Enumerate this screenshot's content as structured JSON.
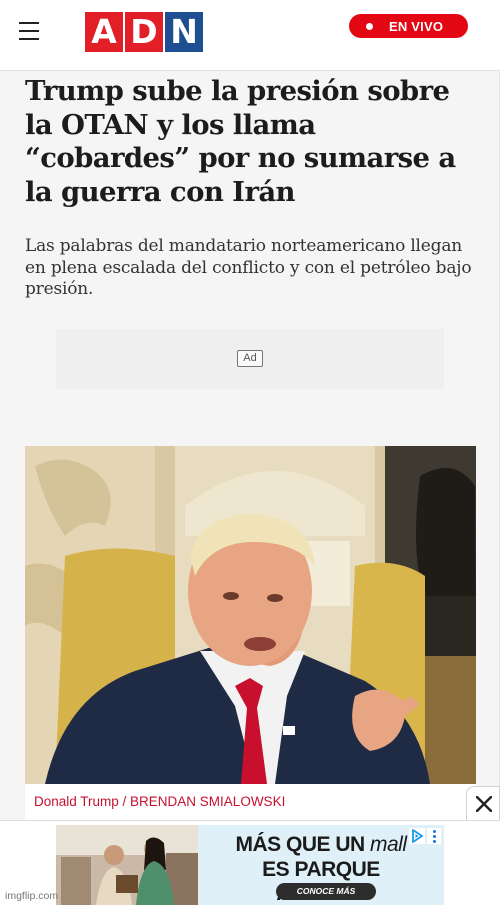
{
  "header": {
    "logo_letters": [
      "A",
      "D",
      "N"
    ],
    "live_label": "EN VIVO",
    "colors": {
      "brand_red": "#e21e26",
      "brand_blue": "#1d4f91",
      "live_red": "#e30613"
    }
  },
  "article": {
    "headline": "Trump sube la presión sobre la OTAN y los llama “cobardes” por no sumarse a la guerra con Irán",
    "subtitle": "Las palabras del mandatario norteamericano llegan en plena escalada del conflicto y con el petróleo bajo presión.",
    "ad_label": "Ad",
    "image_caption": "Donald Trump / BRENDAN SMIALOWSKI"
  },
  "bottom_ad": {
    "line1_text": "MÁS QUE UN ",
    "line1_italic": "mall",
    "line2_text": "ES PARQUE ARAUCO",
    "cta": "CONOCE MÁS",
    "close_icon": "close-icon"
  },
  "watermark": "imgflip.com"
}
